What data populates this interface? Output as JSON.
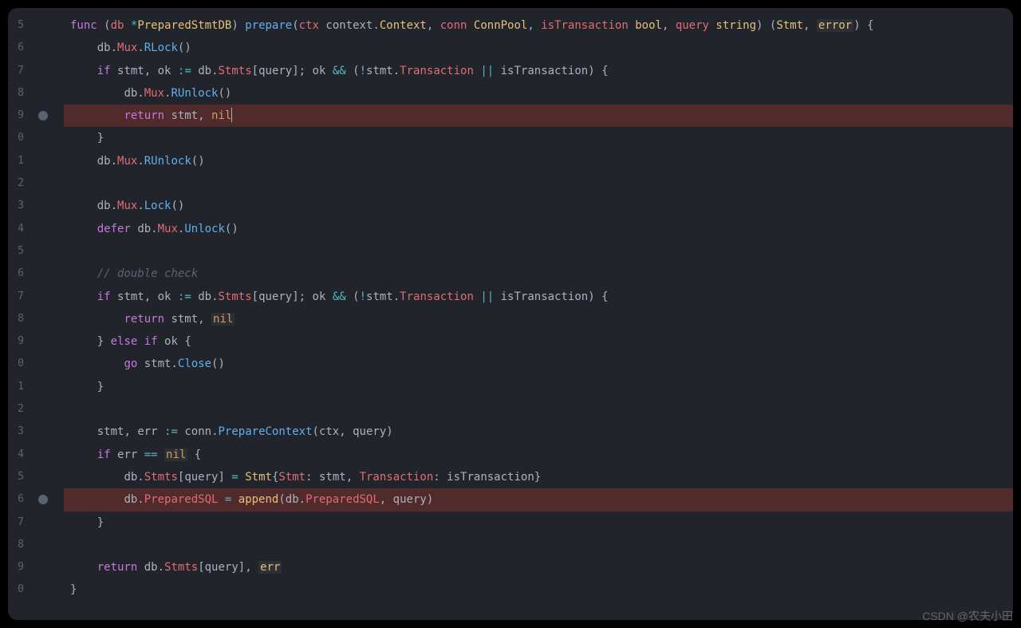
{
  "watermark": "CSDN @农夫小田",
  "lineNumbers": [
    "5",
    "6",
    "7",
    "8",
    "9",
    "0",
    "1",
    "2",
    "3",
    "4",
    "5",
    "6",
    "7",
    "8",
    "9",
    "0",
    "1",
    "2",
    "3",
    "4",
    "5",
    "6",
    "7",
    "8",
    "9",
    "0"
  ],
  "breakpoints": [
    4,
    21
  ],
  "highlightedLines": [
    4,
    21
  ],
  "code": {
    "line0": {
      "func": "func",
      "db": "db",
      "star": "*",
      "PreparedStmtDB": "PreparedStmtDB",
      "prepare": "prepare",
      "ctx": "ctx",
      "context": "context",
      "Context": "Context",
      "conn": "conn",
      "ConnPool": "ConnPool",
      "isTransaction": "isTransaction",
      "bool": "bool",
      "query": "query",
      "string": "string",
      "Stmt": "Stmt",
      "error": "error"
    },
    "line1": {
      "db": "db",
      "Mux": "Mux",
      "RLock": "RLock"
    },
    "line2": {
      "if": "if",
      "stmt": "stmt",
      "ok": "ok",
      "db": "db",
      "Stmts": "Stmts",
      "query": "query",
      "Transaction": "Transaction",
      "isTransaction": "isTransaction"
    },
    "line3": {
      "db": "db",
      "Mux": "Mux",
      "RUnlock": "RUnlock"
    },
    "line4": {
      "return": "return",
      "stmt": "stmt",
      "nil": "nil"
    },
    "line6": {
      "db": "db",
      "Mux": "Mux",
      "RUnlock": "RUnlock"
    },
    "line8": {
      "db": "db",
      "Mux": "Mux",
      "Lock": "Lock"
    },
    "line9": {
      "defer": "defer",
      "db": "db",
      "Mux": "Mux",
      "Unlock": "Unlock"
    },
    "line11": {
      "comment": "// double check"
    },
    "line12": {
      "if": "if",
      "stmt": "stmt",
      "ok": "ok",
      "db": "db",
      "Stmts": "Stmts",
      "query": "query",
      "Transaction": "Transaction",
      "isTransaction": "isTransaction"
    },
    "line13": {
      "return": "return",
      "stmt": "stmt",
      "nil": "nil"
    },
    "line14": {
      "else": "else",
      "if": "if",
      "ok": "ok"
    },
    "line15": {
      "go": "go",
      "stmt": "stmt",
      "Close": "Close"
    },
    "line18": {
      "stmt": "stmt",
      "err": "err",
      "conn": "conn",
      "PrepareContext": "PrepareContext",
      "ctx": "ctx",
      "query": "query"
    },
    "line19": {
      "if": "if",
      "err": "err",
      "nil": "nil"
    },
    "line20": {
      "db": "db",
      "Stmts": "Stmts",
      "query": "query",
      "Stmt": "Stmt",
      "StmtField": "Stmt",
      "stmt": "stmt",
      "Transaction": "Transaction",
      "isTransaction": "isTransaction"
    },
    "line21": {
      "db": "db",
      "PreparedSQL": "PreparedSQL",
      "append": "append",
      "query": "query"
    },
    "line24": {
      "return": "return",
      "db": "db",
      "Stmts": "Stmts",
      "query": "query",
      "err": "err"
    }
  }
}
